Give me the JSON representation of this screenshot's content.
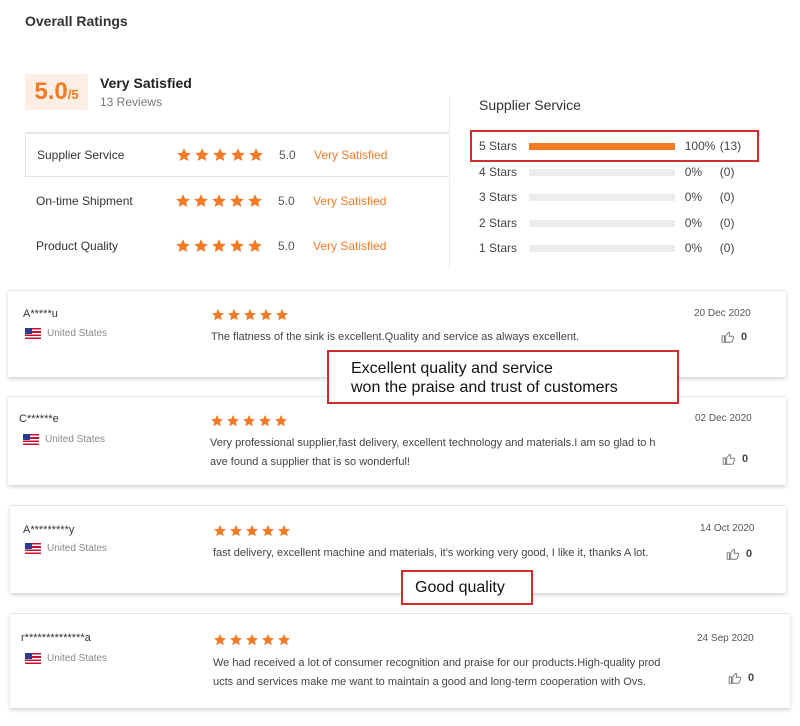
{
  "overall": {
    "title": "Overall Ratings",
    "score": "5.0",
    "score_max": "/5",
    "verdict": "Very Satisfied",
    "review_count": "13 Reviews"
  },
  "categories": [
    {
      "label": "Supplier Service",
      "rating": 5,
      "score": "5.0",
      "verdict": "Very Satisfied"
    },
    {
      "label": "On-time Shipment",
      "rating": 5,
      "score": "5.0",
      "verdict": "Very Satisfied"
    },
    {
      "label": "Product Quality",
      "rating": 5,
      "score": "5.0",
      "verdict": "Very Satisfied"
    }
  ],
  "distribution": {
    "title": "Supplier Service",
    "rows": [
      {
        "label": "5 Stars",
        "fraction": 1.0,
        "percent": "100%",
        "count": "(13)"
      },
      {
        "label": "4 Stars",
        "fraction": 0.0,
        "percent": "0%",
        "count": "(0)"
      },
      {
        "label": "3 Stars",
        "fraction": 0.0,
        "percent": "0%",
        "count": "(0)"
      },
      {
        "label": "2 Stars",
        "fraction": 0.0,
        "percent": "0%",
        "count": "(0)"
      },
      {
        "label": "1 Stars",
        "fraction": 0.0,
        "percent": "0%",
        "count": "(0)"
      }
    ]
  },
  "reviews": [
    {
      "name": "A*****u",
      "country": "United States",
      "rating": 5,
      "date": "20 Dec 2020",
      "text_lines": [
        "The flatness of the sink is excellent.Quality and service as always excellent."
      ],
      "likes": "0"
    },
    {
      "name": "C******e",
      "country": "United States",
      "rating": 5,
      "date": "02 Dec 2020",
      "text_lines": [
        "Very professional supplier,fast delivery, excellent technology and materials.I am so glad to h",
        "ave found a supplier that is so wonderful!"
      ],
      "likes": "0"
    },
    {
      "name": "A*********y",
      "country": "United States",
      "rating": 5,
      "date": "14 Oct 2020",
      "text_lines": [
        "fast delivery, excellent machine and materials, it's working very good, I like it, thanks A lot."
      ],
      "likes": "0"
    },
    {
      "name": "r**************a",
      "country": "United States",
      "rating": 5,
      "date": "24 Sep 2020",
      "text_lines": [
        "We had received a lot of consumer recognition and praise for our products.High-quality prod",
        "ucts and services make me want to maintain a good and long-term cooperation with Ovs."
      ],
      "likes": "0"
    }
  ],
  "callouts": {
    "praise_line1": "Excellent quality and service",
    "praise_line2": "won the praise and trust of customers",
    "quality": "Good quality"
  },
  "colors": {
    "accent": "#f47a26",
    "highlight_border": "#d42c2c"
  },
  "icons": {
    "star": "star-icon",
    "like": "thumbs-up-icon",
    "flag": "us-flag-icon"
  }
}
